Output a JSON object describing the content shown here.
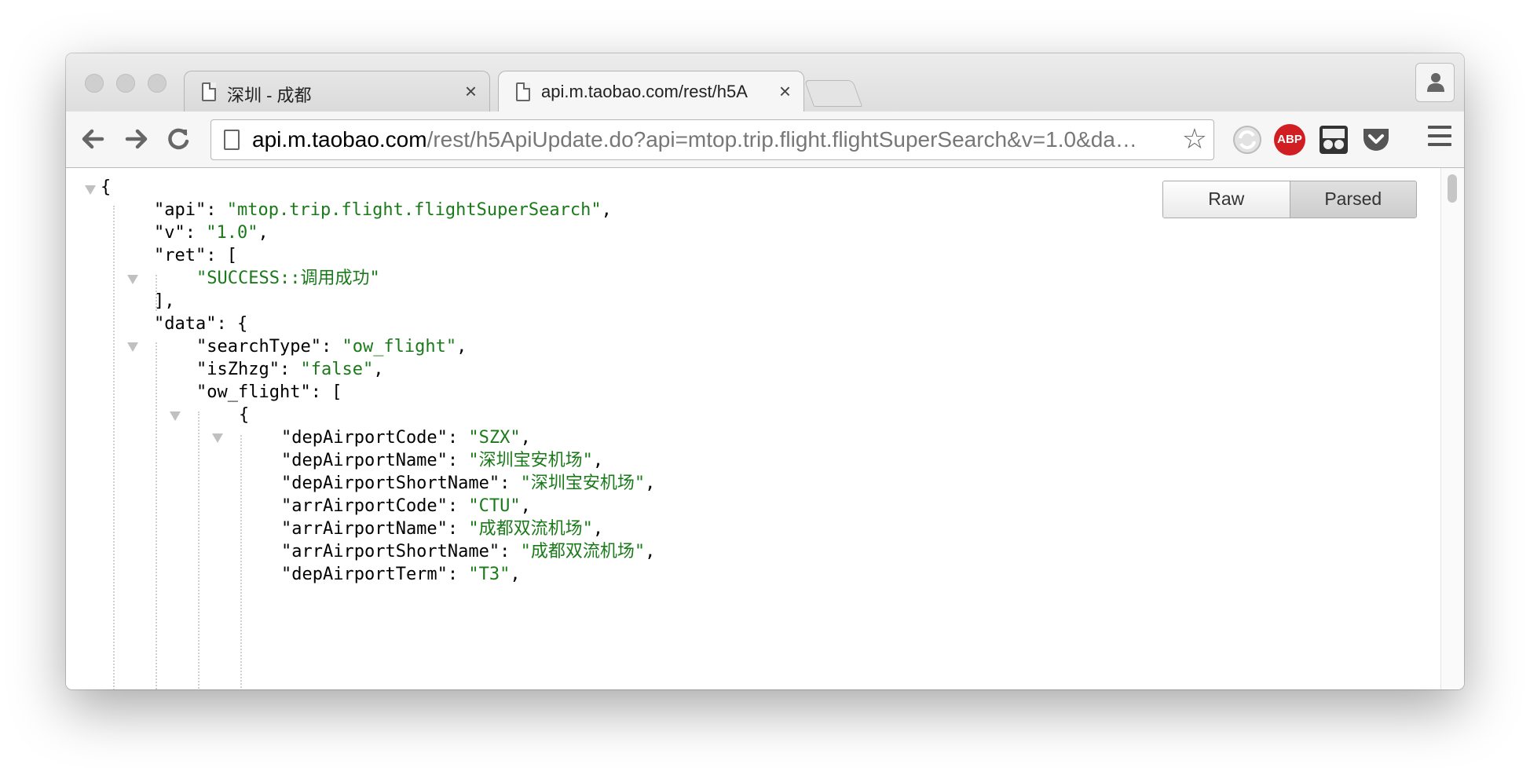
{
  "window": {
    "tabs": [
      {
        "title": "深圳 - 成都",
        "close": "×"
      },
      {
        "title": "api.m.taobao.com/rest/h5A",
        "close": "×"
      }
    ]
  },
  "toolbar": {
    "url_host": "api.m.taobao.com",
    "url_rest": "/rest/h5ApiUpdate.do?api=mtop.trip.flight.flightSuperSearch&v=1.0&da…",
    "star": "☆",
    "abp_label": "ABP"
  },
  "viewer": {
    "raw_label": "Raw",
    "parsed_label": "Parsed"
  },
  "json_lines": {
    "l0": "{",
    "l1_key": "\"api\"",
    "l1_val": "\"mtop.trip.flight.flightSuperSearch\"",
    "l2_key": "\"v\"",
    "l2_val": "\"1.0\"",
    "l3_key": "\"ret\"",
    "l3_open": "[",
    "l4_val": "\"SUCCESS::调用成功\"",
    "l5": "],",
    "l6_key": "\"data\"",
    "l6_open": "{",
    "l7_key": "\"searchType\"",
    "l7_val": "\"ow_flight\"",
    "l8_key": "\"isZhzg\"",
    "l8_val": "\"false\"",
    "l9_key": "\"ow_flight\"",
    "l9_open": "[",
    "l10": "{",
    "l11_key": "\"depAirportCode\"",
    "l11_val": "\"SZX\"",
    "l12_key": "\"depAirportName\"",
    "l12_val": "\"深圳宝安机场\"",
    "l13_key": "\"depAirportShortName\"",
    "l13_val": "\"深圳宝安机场\"",
    "l14_key": "\"arrAirportCode\"",
    "l14_val": "\"CTU\"",
    "l15_key": "\"arrAirportName\"",
    "l15_val": "\"成都双流机场\"",
    "l16_key": "\"arrAirportShortName\"",
    "l16_val": "\"成都双流机场\"",
    "l17_key": "\"depAirportTerm\"",
    "l17_val": "\"T3\""
  }
}
